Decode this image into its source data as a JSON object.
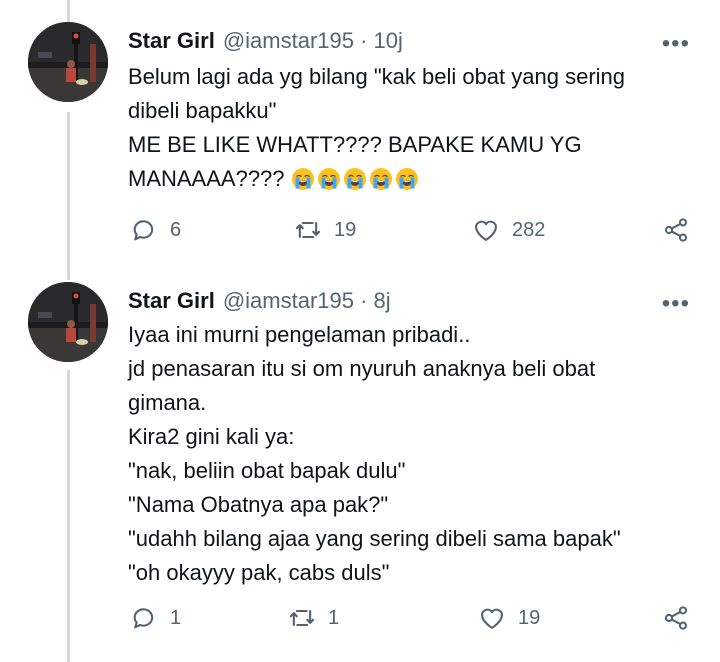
{
  "tweets": [
    {
      "author_name": "Star Girl",
      "handle_time": "@iamstar195 · 10j",
      "lines": [
        "Belum lagi ada yg bilang \"kak beli obat yang sering",
        "dibeli bapakku\"",
        "ME BE LIKE WHATT????  BAPAKE KAMU YG",
        "MANAAAA????"
      ],
      "emoji_icon": "loudly-crying-face-emoji",
      "emoji_count": 5,
      "reply_count": "6",
      "retweet_count": "19",
      "like_count": "282"
    },
    {
      "author_name": "Star Girl",
      "handle_time": "@iamstar195 · 8j",
      "lines": [
        "Iyaa ini murni pengelaman pribadi..",
        "jd penasaran itu si om nyuruh anaknya beli obat",
        "gimana.",
        "Kira2 gini kali ya:",
        "\"nak, beliin obat bapak dulu\"",
        "\"Nama Obatnya apa pak?\"",
        "\"udahh bilang ajaa yang sering dibeli sama bapak\"",
        "\"oh okayyy pak, cabs duls\""
      ],
      "reply_count": "1",
      "retweet_count": "1",
      "like_count": "19"
    }
  ],
  "icons": {
    "more": "more-options-icon",
    "reply": "reply-icon",
    "retweet": "retweet-icon",
    "like": "heart-icon",
    "share": "share-icon"
  },
  "colors": {
    "text": "#0f1419",
    "secondary": "#536471",
    "thread_line": "#cfd9de"
  }
}
